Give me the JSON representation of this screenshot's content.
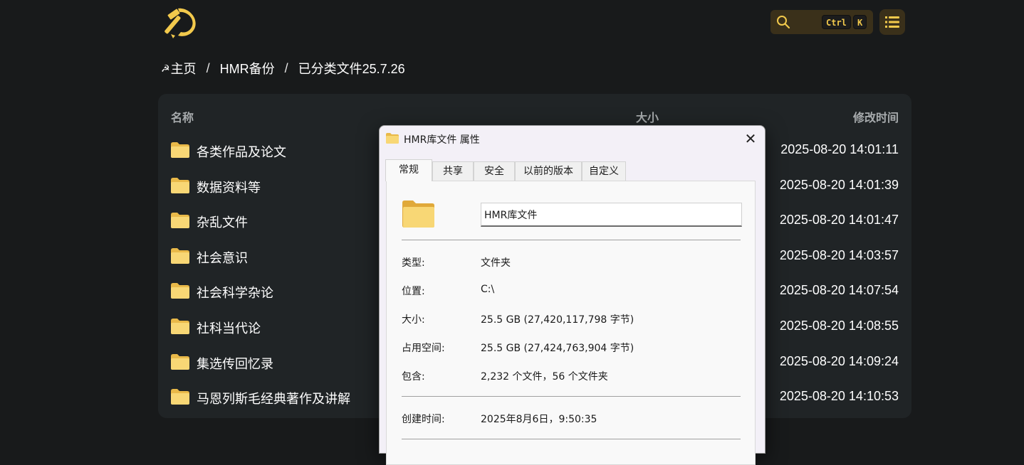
{
  "header": {
    "logo_icon": "hammer-sickle-icon",
    "search": {
      "icon": "search-icon",
      "shortcut_keys": [
        "Ctrl",
        "K"
      ]
    },
    "menu_icon": "list-menu-icon",
    "accent_color": "#f2c94c"
  },
  "breadcrumb": {
    "home_icon": "☭",
    "items": [
      "主页",
      "HMR备份",
      "已分类文件25.7.26"
    ],
    "separator": "/"
  },
  "table": {
    "headers": {
      "name": "名称",
      "size": "大小",
      "modified": "修改时间"
    },
    "rows": [
      {
        "name": "各类作品及论文",
        "modified": "2025-08-20 14:01:11"
      },
      {
        "name": "数据资料等",
        "modified": "2025-08-20 14:01:39"
      },
      {
        "name": "杂乱文件",
        "modified": "2025-08-20 14:01:47"
      },
      {
        "name": "社会意识",
        "modified": "2025-08-20 14:03:57"
      },
      {
        "name": "社会科学杂论",
        "modified": "2025-08-20 14:07:54"
      },
      {
        "name": "社科当代论",
        "modified": "2025-08-20 14:08:55"
      },
      {
        "name": "集选传回忆录",
        "modified": "2025-08-20 14:09:24"
      },
      {
        "name": "马恩列斯毛经典著作及讲解",
        "modified": "2025-08-20 14:10:53"
      }
    ]
  },
  "dialog": {
    "title": "HMR库文件 属性",
    "close_glyph": "✕",
    "tabs": [
      "常规",
      "共享",
      "安全",
      "以前的版本",
      "自定义"
    ],
    "active_tab": "常规",
    "name_value": "HMR库文件",
    "props": [
      {
        "label": "类型:",
        "value": "文件夹"
      },
      {
        "label": "位置:",
        "value": "C:\\"
      },
      {
        "label": "大小:",
        "value": "25.5 GB (27,420,117,798 字节)"
      },
      {
        "label": "占用空间:",
        "value": "25.5 GB (27,424,763,904 字节)"
      },
      {
        "label": "包含:",
        "value": "2,232 个文件，56 个文件夹"
      }
    ],
    "created": {
      "label": "创建时间:",
      "value": "2025年8月6日，9:50:35"
    }
  }
}
